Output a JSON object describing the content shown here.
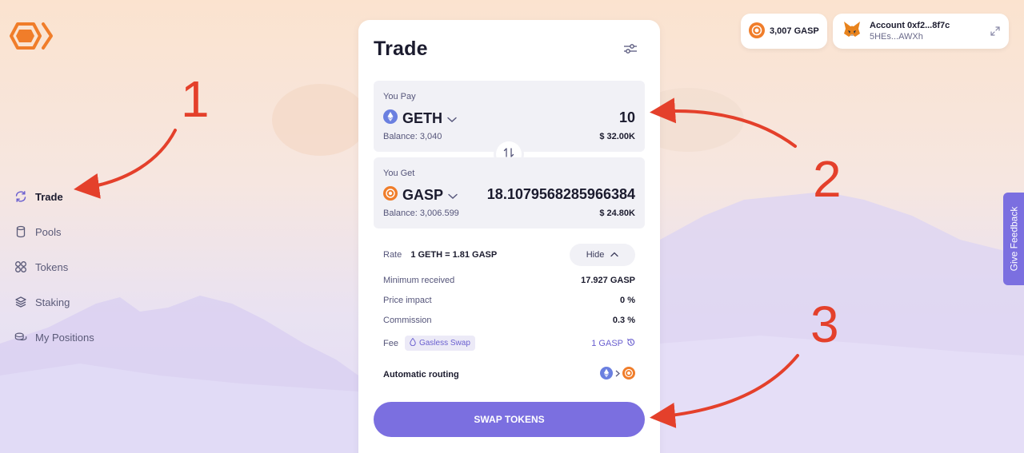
{
  "sidebar": {
    "items": [
      {
        "label": "Trade",
        "icon": "refresh-icon"
      },
      {
        "label": "Pools",
        "icon": "cylinder-icon"
      },
      {
        "label": "Tokens",
        "icon": "grid-circles-icon"
      },
      {
        "label": "Staking",
        "icon": "layers-icon"
      },
      {
        "label": "My Positions",
        "icon": "coins-icon"
      }
    ]
  },
  "header": {
    "balance": "3,007 GASP",
    "account_name": "Account 0xf2...8f7c",
    "account_address": "5HEs...AWXh"
  },
  "trade": {
    "title": "Trade",
    "pay": {
      "label": "You Pay",
      "token": "GETH",
      "amount": "10",
      "balance": "Balance: 3,040",
      "usd": "$ 32.00K"
    },
    "get": {
      "label": "You Get",
      "token": "GASP",
      "amount": "18.1079568285966384",
      "balance": "Balance: 3,006.599",
      "usd": "$ 24.80K"
    },
    "rate_label": "Rate",
    "rate_value": "1 GETH = 1.81 GASP",
    "hide_label": "Hide",
    "details": {
      "min_received_label": "Minimum received",
      "min_received_value": "17.927 GASP",
      "price_impact_label": "Price impact",
      "price_impact_value": "0 %",
      "commission_label": "Commission",
      "commission_value": "0.3 %",
      "fee_label": "Fee",
      "fee_badge": "Gasless Swap",
      "fee_value": "1 GASP",
      "routing_label": "Automatic routing"
    },
    "swap_button": "SWAP TOKENS"
  },
  "annotations": [
    "1",
    "2",
    "3"
  ],
  "feedback_label": "Give Feedback",
  "colors": {
    "accent": "#7b6fe0",
    "annotation": "#e4402b",
    "gasp_orange": "#f07d2a",
    "eth_blue": "#6a7fe0"
  }
}
